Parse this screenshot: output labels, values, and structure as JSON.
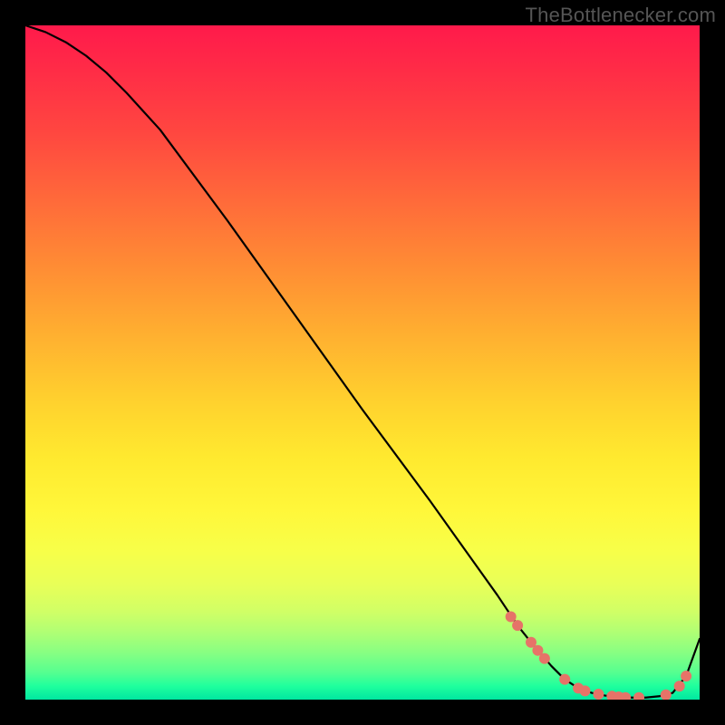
{
  "watermark": "TheBottlenecker.com",
  "colors": {
    "curve": "#000000",
    "marker": "#e67368",
    "background_border": "#000000"
  },
  "chart_data": {
    "type": "line",
    "title": "",
    "xlabel": "",
    "ylabel": "",
    "xlim": [
      0,
      100
    ],
    "ylim": [
      0,
      100
    ],
    "grid": false,
    "legend": false,
    "series": [
      {
        "name": "bottleneck-curve",
        "x": [
          0,
          3,
          6,
          9,
          12,
          15,
          20,
          30,
          40,
          50,
          60,
          65,
          70,
          73,
          75,
          78,
          80,
          82,
          84,
          86,
          88,
          90,
          92,
          94,
          96,
          98,
          100
        ],
        "y": [
          100,
          99,
          97.5,
          95.5,
          93,
          90,
          84.5,
          71,
          57,
          43,
          29.5,
          22.5,
          15.5,
          11,
          8.5,
          5,
          3,
          1.7,
          1,
          0.6,
          0.4,
          0.3,
          0.3,
          0.5,
          1,
          3.5,
          9
        ]
      }
    ],
    "annotations": {
      "markers_along_curve": [
        {
          "x": 72,
          "y": 12.3
        },
        {
          "x": 73,
          "y": 11.0
        },
        {
          "x": 75,
          "y": 8.5
        },
        {
          "x": 76,
          "y": 7.3
        },
        {
          "x": 77,
          "y": 6.1
        },
        {
          "x": 80,
          "y": 3.0
        },
        {
          "x": 82,
          "y": 1.7
        },
        {
          "x": 83,
          "y": 1.3
        },
        {
          "x": 85,
          "y": 0.8
        },
        {
          "x": 87,
          "y": 0.5
        },
        {
          "x": 88,
          "y": 0.4
        },
        {
          "x": 89,
          "y": 0.3
        },
        {
          "x": 91,
          "y": 0.3
        },
        {
          "x": 95,
          "y": 0.7
        },
        {
          "x": 97,
          "y": 2.0
        },
        {
          "x": 98,
          "y": 3.5
        }
      ]
    }
  }
}
